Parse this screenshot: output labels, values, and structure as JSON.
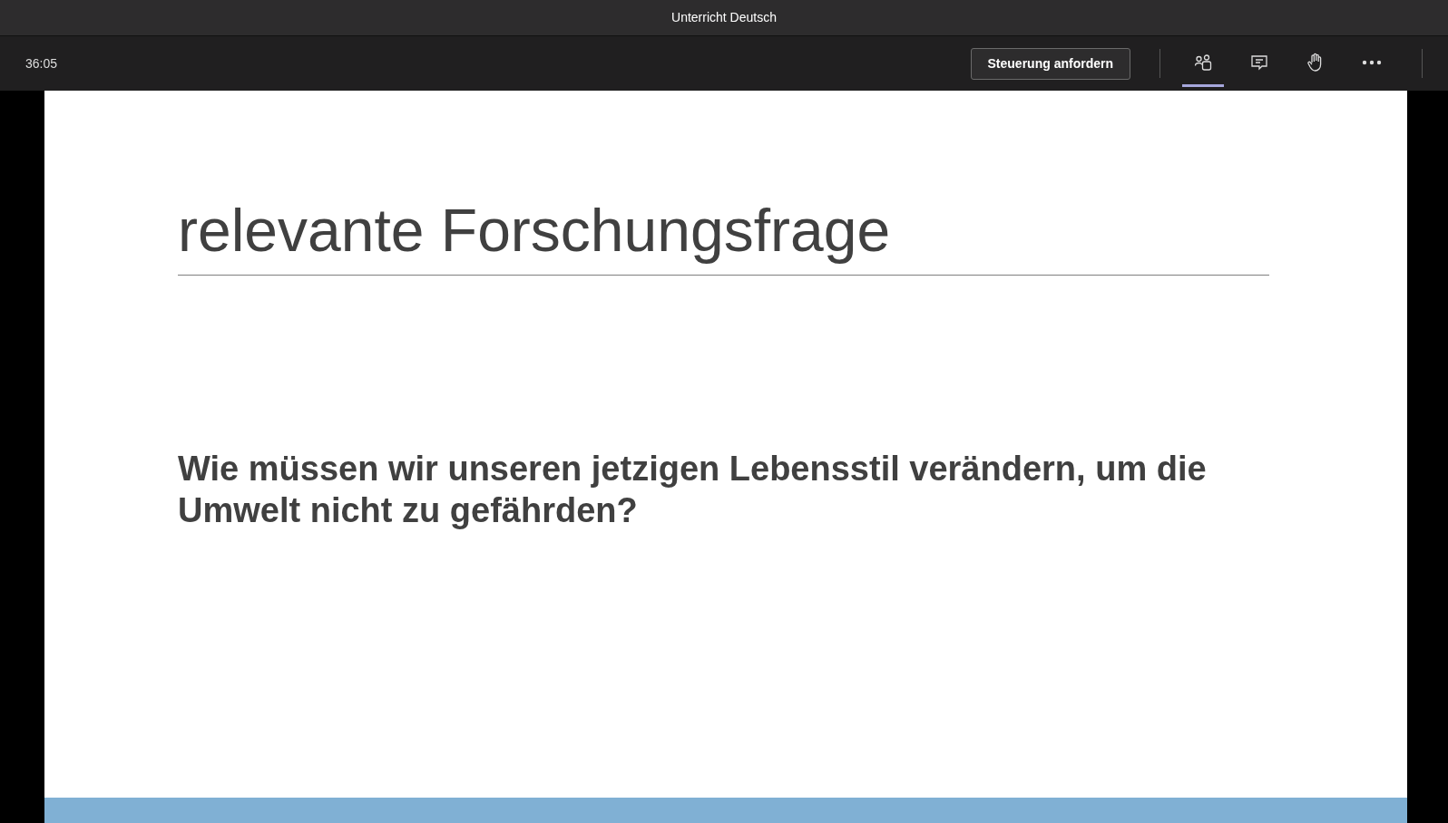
{
  "window": {
    "title": "Unterricht Deutsch"
  },
  "toolbar": {
    "timer": "36:05",
    "control_button": "Steuerung anfordern",
    "tools": [
      {
        "kind": "people",
        "selected": true
      },
      {
        "kind": "chat",
        "selected": false
      },
      {
        "kind": "hand",
        "selected": false
      },
      {
        "kind": "more",
        "selected": false
      }
    ]
  },
  "slide": {
    "title": "relevante Forschungsfrage",
    "question": "Wie müssen wir unseren jetzigen Lebensstil verändern, um die Umwelt nicht zu gefährden?"
  }
}
